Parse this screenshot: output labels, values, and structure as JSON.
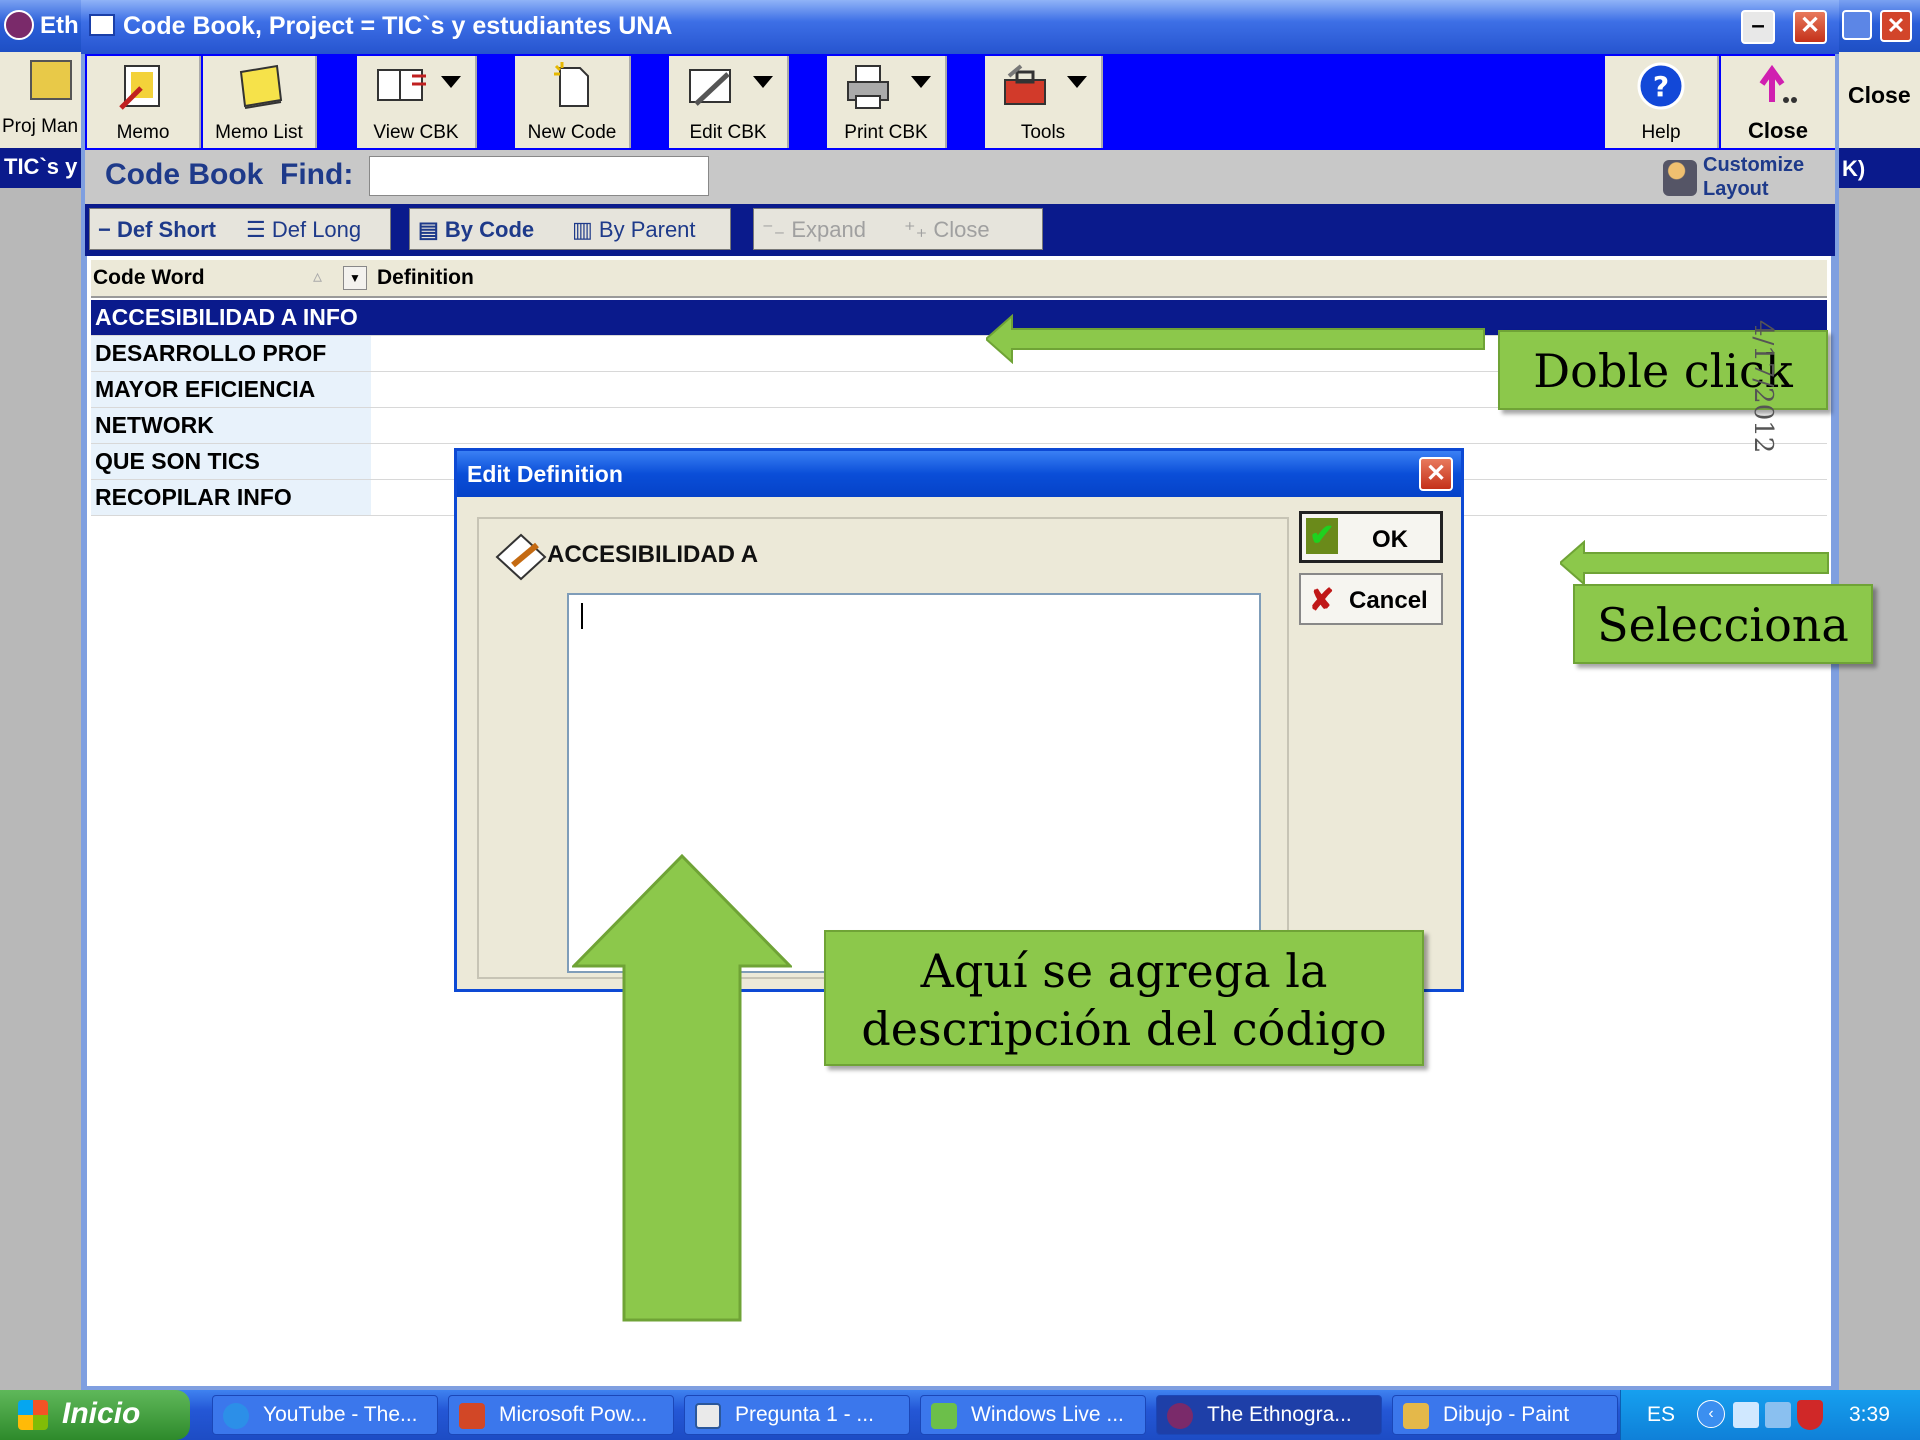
{
  "background_window": {
    "title": "Eth",
    "toolbar_item": "Proj Man",
    "close_label": "Close",
    "project_label": "TIC`s y",
    "row_suffix": "K)"
  },
  "main_window": {
    "title": "Code Book, Project = TIC`s y estudiantes UNA",
    "toolbar": {
      "memo": "Memo",
      "memo_list": "Memo List",
      "view_cbk": "View CBK",
      "new_code": "New Code",
      "edit_cbk": "Edit CBK",
      "print_cbk": "Print CBK",
      "tools": "Tools",
      "help": "Help",
      "close": "Close"
    },
    "findbar": {
      "title": "Code Book",
      "find_label": "Find:",
      "find_value": "",
      "customize_line1": "Customize",
      "customize_line2": "Layout"
    },
    "viewbar": {
      "def_short": "Def Short",
      "def_long": "Def Long",
      "by_code": "By Code",
      "by_parent": "By Parent",
      "expand": "Expand",
      "close": "Close"
    },
    "grid": {
      "columns": [
        "Code Word",
        "Definition"
      ],
      "rows": [
        {
          "code": "ACCESIBILIDAD A INFO",
          "definition": ""
        },
        {
          "code": "DESARROLLO PROF",
          "definition": ""
        },
        {
          "code": "MAYOR EFICIENCIA",
          "definition": ""
        },
        {
          "code": "NETWORK",
          "definition": ""
        },
        {
          "code": "QUE SON TICS",
          "definition": ""
        },
        {
          "code": "RECOPILAR INFO",
          "definition": ""
        }
      ]
    }
  },
  "dialog": {
    "title": "Edit Definition",
    "code_name": "ACCESIBILIDAD A",
    "definition_text": "",
    "ok": "OK",
    "cancel": "Cancel"
  },
  "annotations": {
    "doble_click": "Doble click",
    "selecciona": "Selecciona",
    "aqui_line1": "Aquí se agrega la",
    "aqui_line2": "descripción del código",
    "date": "4/17/2012",
    "arrow_color": "#8cc84b"
  },
  "taskbar": {
    "start": "Inicio",
    "tasks": [
      "YouTube - The...",
      "Microsoft Pow...",
      "Pregunta 1 - ...",
      "Windows Live ...",
      "The Ethnogra...",
      "Dibujo - Paint"
    ],
    "lang": "ES",
    "time": "3:39"
  }
}
